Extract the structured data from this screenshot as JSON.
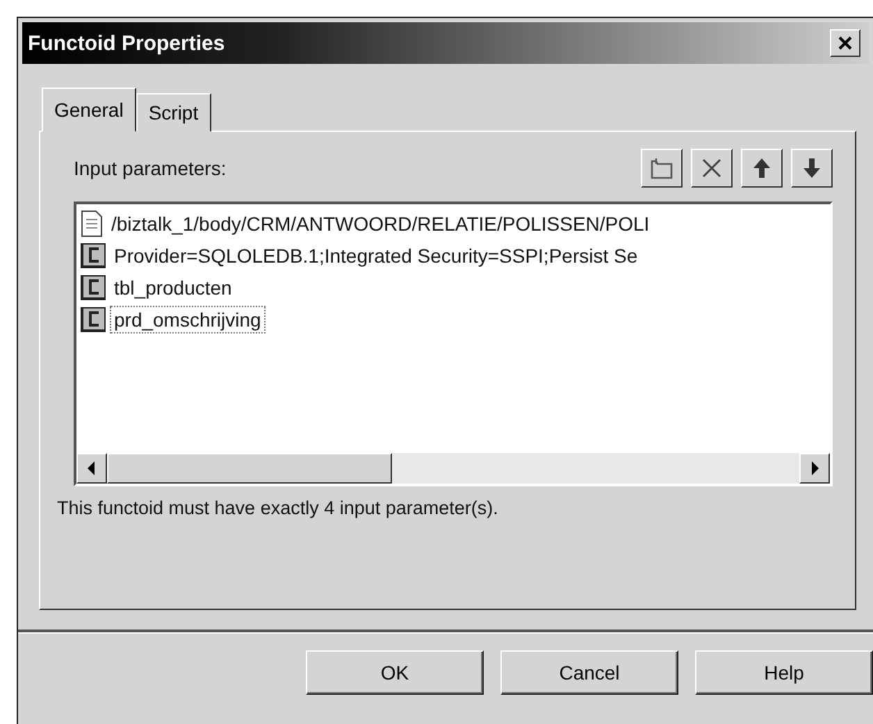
{
  "window": {
    "title": "Functoid Properties"
  },
  "tabs": [
    {
      "label": "General",
      "selected": true
    },
    {
      "label": "Script",
      "selected": false
    }
  ],
  "input_parameters": {
    "label": "Input parameters:",
    "items": [
      {
        "kind": "link",
        "text": "/biztalk_1/body/CRM/ANTWOORD/RELATIE/POLISSEN/POLI",
        "focused": false
      },
      {
        "kind": "constant",
        "text": "Provider=SQLOLEDB.1;Integrated Security=SSPI;Persist Se",
        "focused": false
      },
      {
        "kind": "constant",
        "text": "tbl_producten",
        "focused": false
      },
      {
        "kind": "constant",
        "text": "prd_omschrijving",
        "focused": true
      }
    ]
  },
  "message": "This functoid must have exactly 4 input parameter(s).",
  "buttons": [
    "OK",
    "Cancel",
    "Help"
  ]
}
